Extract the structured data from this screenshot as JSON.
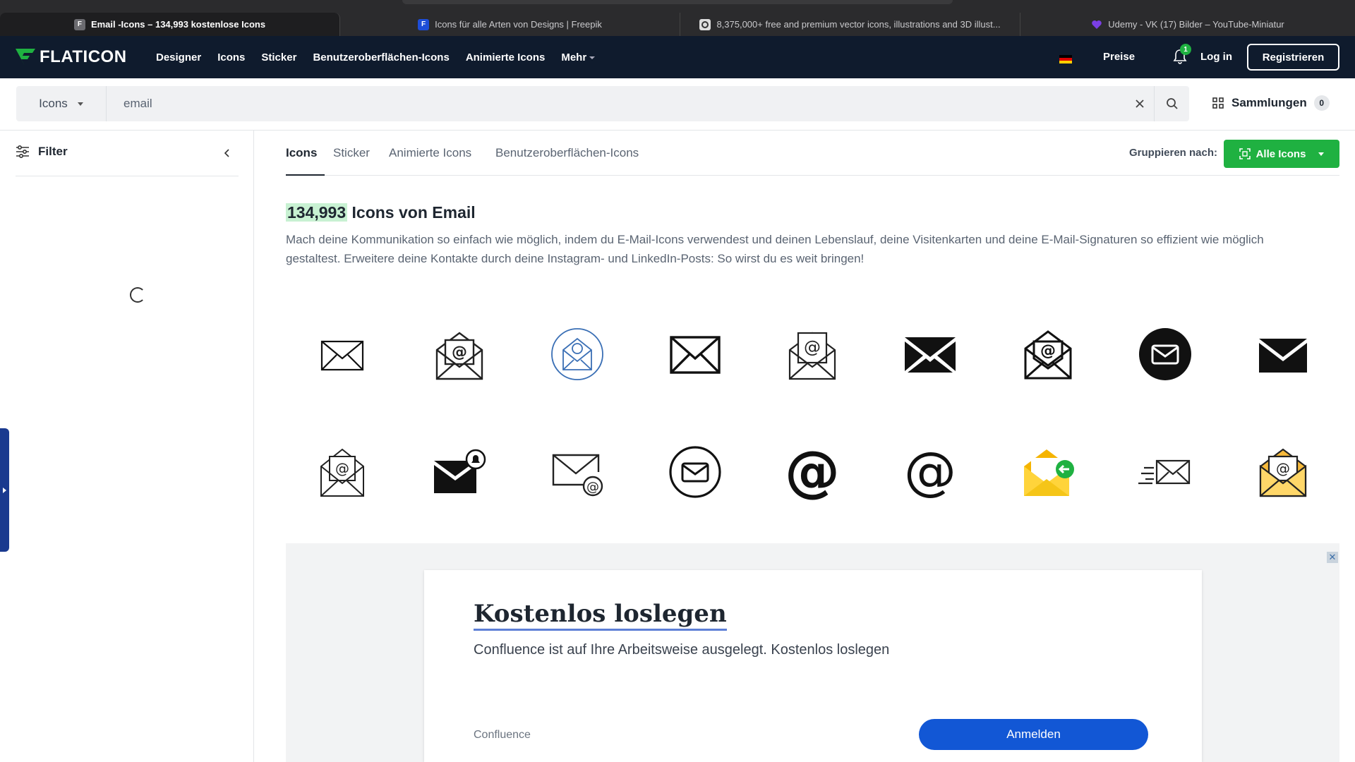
{
  "browser": {
    "tabs": [
      {
        "title": "Email -Icons – 134,993 kostenlose Icons",
        "favicon": "F",
        "favicon_color": "#6b6b70",
        "active": true
      },
      {
        "title": "Icons für alle Arten von Designs | Freepik",
        "favicon": "F",
        "favicon_color": "#1d4dd8",
        "active": false
      },
      {
        "title": "8,375,000+ free and premium vector icons, illustrations and 3D illust...",
        "favicon": "camera-icon",
        "favicon_color": "#dddddd",
        "active": false
      },
      {
        "title": "Udemy - VK (17) Bilder – YouTube-Miniatur",
        "favicon": "heart-icon",
        "favicon_color": "#7b3fe4",
        "active": false
      }
    ]
  },
  "nav": {
    "logo_text": "FLATICON",
    "links": [
      "Designer",
      "Icons",
      "Sticker",
      "Benutzeroberflächen-Icons",
      "Animierte Icons",
      "Mehr"
    ],
    "pricing": "Preise",
    "notification_count": "1",
    "login": "Log in",
    "register": "Registrieren",
    "colors": {
      "bg": "#0f1b2d",
      "accent": "#1fb141"
    }
  },
  "search": {
    "type": "Icons",
    "query": "email",
    "collections_label": "Sammlungen",
    "collections_count": "0"
  },
  "sidebar": {
    "filter_label": "Filter"
  },
  "main": {
    "tabs": [
      "Icons",
      "Sticker",
      "Animierte Icons",
      "Benutzeroberflächen-Icons"
    ],
    "active_tab": "Icons",
    "group_by_label": "Gruppieren nach:",
    "group_by_value": "Alle Icons",
    "result_count": "134,993",
    "heading_suffix": " Icons von Email",
    "description": "Mach deine Kommunikation so einfach wie möglich, indem du E-Mail-Icons verwendest und deinen Lebenslauf, deine Visitenkarten und deine E-Mail-Signaturen so effizient wie möglich gestaltest. Erweitere deine Kontakte durch deine Instagram- und LinkedIn-Posts: So wirst du es weit bringen!",
    "icons": [
      {
        "name": "envelope-outline-icon"
      },
      {
        "name": "open-envelope-at-icon"
      },
      {
        "name": "circle-envelope-arrow-icon"
      },
      {
        "name": "envelope-bold-outline-icon"
      },
      {
        "name": "open-envelope-at-outline-icon"
      },
      {
        "name": "envelope-filled-icon"
      },
      {
        "name": "open-envelope-at-bold-icon"
      },
      {
        "name": "circle-envelope-filled-icon"
      },
      {
        "name": "envelope-solid-icon"
      },
      {
        "name": "open-envelope-at-thin-icon"
      },
      {
        "name": "envelope-notification-icon"
      },
      {
        "name": "envelope-at-badge-icon"
      },
      {
        "name": "circle-envelope-outline-icon"
      },
      {
        "name": "at-sign-bold-icon"
      },
      {
        "name": "at-sign-outline-icon"
      },
      {
        "name": "yellow-envelope-arrow-icon"
      },
      {
        "name": "fast-envelope-icon"
      },
      {
        "name": "yellow-open-envelope-at-icon"
      }
    ]
  },
  "ad": {
    "title": "Kostenlos loslegen",
    "text": "Confluence ist auf Ihre Arbeitsweise ausgelegt. Kostenlos loslegen",
    "brand": "Confluence",
    "button": "Anmelden"
  }
}
